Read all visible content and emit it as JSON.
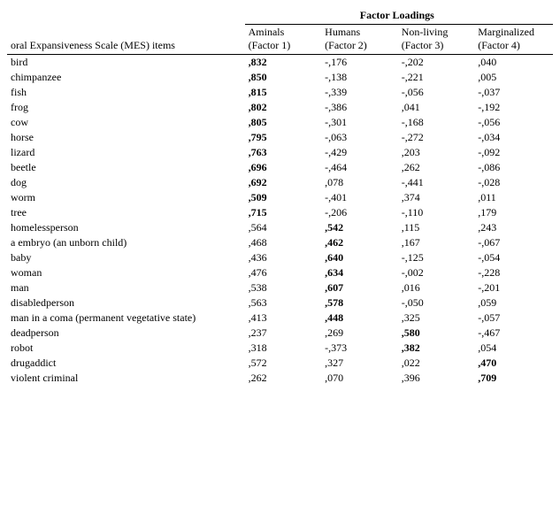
{
  "title": "Factor Loadings",
  "section_label": "oral Expansiveness Scale (MES) items",
  "columns": [
    {
      "id": "animals",
      "label": "Aminals",
      "sublabel": "(Factor 1)"
    },
    {
      "id": "humans",
      "label": "Humans",
      "sublabel": "(Factor 2)"
    },
    {
      "id": "nonliving",
      "label": "Non-living",
      "sublabel": "(Factor 3)"
    },
    {
      "id": "marginalized",
      "label": "Marginalized",
      "sublabel": "(Factor 4)"
    }
  ],
  "rows": [
    {
      "item": "bird",
      "f1": ",832",
      "f1bold": true,
      "f2": "-,176",
      "f2bold": false,
      "f3": "-,202",
      "f3bold": false,
      "f4": ",040",
      "f4bold": false
    },
    {
      "item": "chimpanzee",
      "f1": ",850",
      "f1bold": true,
      "f2": "-,138",
      "f2bold": false,
      "f3": "-,221",
      "f3bold": false,
      "f4": ",005",
      "f4bold": false
    },
    {
      "item": "fish",
      "f1": ",815",
      "f1bold": true,
      "f2": "-,339",
      "f2bold": false,
      "f3": "-,056",
      "f3bold": false,
      "f4": "-,037",
      "f4bold": false
    },
    {
      "item": "frog",
      "f1": ",802",
      "f1bold": true,
      "f2": "-,386",
      "f2bold": false,
      "f3": ",041",
      "f3bold": false,
      "f4": "-,192",
      "f4bold": false
    },
    {
      "item": "cow",
      "f1": ",805",
      "f1bold": true,
      "f2": "-,301",
      "f2bold": false,
      "f3": "-,168",
      "f3bold": false,
      "f4": "-,056",
      "f4bold": false
    },
    {
      "item": "horse",
      "f1": ",795",
      "f1bold": true,
      "f2": "-,063",
      "f2bold": false,
      "f3": "-,272",
      "f3bold": false,
      "f4": "-,034",
      "f4bold": false
    },
    {
      "item": "lizard",
      "f1": ",763",
      "f1bold": true,
      "f2": "-,429",
      "f2bold": false,
      "f3": ",203",
      "f3bold": false,
      "f4": "-,092",
      "f4bold": false
    },
    {
      "item": "beetle",
      "f1": ",696",
      "f1bold": true,
      "f2": "-,464",
      "f2bold": false,
      "f3": ",262",
      "f3bold": false,
      "f4": "-,086",
      "f4bold": false
    },
    {
      "item": "dog",
      "f1": ",692",
      "f1bold": true,
      "f2": ",078",
      "f2bold": false,
      "f3": "-,441",
      "f3bold": false,
      "f4": "-,028",
      "f4bold": false
    },
    {
      "item": "worm",
      "f1": ",509",
      "f1bold": true,
      "f2": "-,401",
      "f2bold": false,
      "f3": ",374",
      "f3bold": false,
      "f4": ",011",
      "f4bold": false
    },
    {
      "item": "tree",
      "f1": ",715",
      "f1bold": true,
      "f2": "-,206",
      "f2bold": false,
      "f3": "-,110",
      "f3bold": false,
      "f4": ",179",
      "f4bold": false
    },
    {
      "item": "homelessperson",
      "f1": ",564",
      "f1bold": false,
      "f2": ",542",
      "f2bold": true,
      "f3": ",115",
      "f3bold": false,
      "f4": ",243",
      "f4bold": false
    },
    {
      "item": "a embryo (an unborn child)",
      "f1": ",468",
      "f1bold": false,
      "f2": ",462",
      "f2bold": true,
      "f3": ",167",
      "f3bold": false,
      "f4": "-,067",
      "f4bold": false
    },
    {
      "item": "baby",
      "f1": ",436",
      "f1bold": false,
      "f2": ",640",
      "f2bold": true,
      "f3": "-,125",
      "f3bold": false,
      "f4": "-,054",
      "f4bold": false
    },
    {
      "item": "woman",
      "f1": ",476",
      "f1bold": false,
      "f2": ",634",
      "f2bold": true,
      "f3": "-,002",
      "f3bold": false,
      "f4": "-,228",
      "f4bold": false
    },
    {
      "item": "man",
      "f1": ",538",
      "f1bold": false,
      "f2": ",607",
      "f2bold": true,
      "f3": ",016",
      "f3bold": false,
      "f4": "-,201",
      "f4bold": false
    },
    {
      "item": "disabledperson",
      "f1": ",563",
      "f1bold": false,
      "f2": ",578",
      "f2bold": true,
      "f3": "-,050",
      "f3bold": false,
      "f4": ",059",
      "f4bold": false
    },
    {
      "item": "man in a coma (permanent vegetative state)",
      "f1": ",413",
      "f1bold": false,
      "f2": ",448",
      "f2bold": true,
      "f3": ",325",
      "f3bold": false,
      "f4": "-,057",
      "f4bold": false
    },
    {
      "item": "deadperson",
      "f1": ",237",
      "f1bold": false,
      "f2": ",269",
      "f2bold": false,
      "f3": ",580",
      "f3bold": true,
      "f4": "-,467",
      "f4bold": false
    },
    {
      "item": "robot",
      "f1": ",318",
      "f1bold": false,
      "f2": "-,373",
      "f2bold": false,
      "f3": ",382",
      "f3bold": true,
      "f4": ",054",
      "f4bold": false
    },
    {
      "item": "drugaddict",
      "f1": ",572",
      "f1bold": false,
      "f2": ",327",
      "f2bold": false,
      "f3": ",022",
      "f3bold": false,
      "f4": ",470",
      "f4bold": true
    },
    {
      "item": "violent criminal",
      "f1": ",262",
      "f1bold": false,
      "f2": ",070",
      "f2bold": false,
      "f3": ",396",
      "f3bold": false,
      "f4": ",709",
      "f4bold": true
    }
  ]
}
